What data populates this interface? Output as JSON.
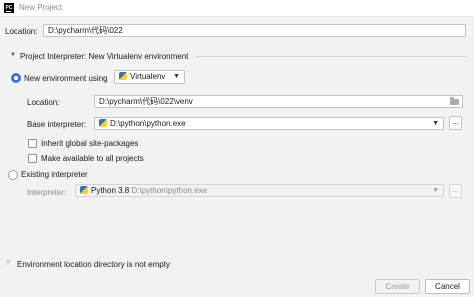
{
  "window": {
    "title": "New Project",
    "logo_text": "PC"
  },
  "location": {
    "label": "Location:",
    "value": "D:\\pycharm\\代码\\022"
  },
  "interpreter_section": {
    "title": "Project Interpreter: New Virtualenv environment"
  },
  "new_env": {
    "radio_label": "New environment using",
    "tool_value": "Virtualenv",
    "location_label": "Location:",
    "location_value": "D:\\pycharm\\代码\\022\\venv",
    "base_label": "Base interpreter:",
    "base_value": "D:\\python\\python.exe",
    "more_label": "...",
    "inherit_label": "Inherit global site-packages",
    "available_label": "Make available to all projects"
  },
  "existing": {
    "radio_label": "Existing interpreter",
    "interpreter_label": "Interpreter:",
    "interpreter_name": "Python 3.8",
    "interpreter_path": "D:\\python\\python.exe",
    "more_label": "..."
  },
  "warning": {
    "text": "Environment location directory is not empty"
  },
  "buttons": {
    "create": "Create",
    "cancel": "Cancel"
  }
}
